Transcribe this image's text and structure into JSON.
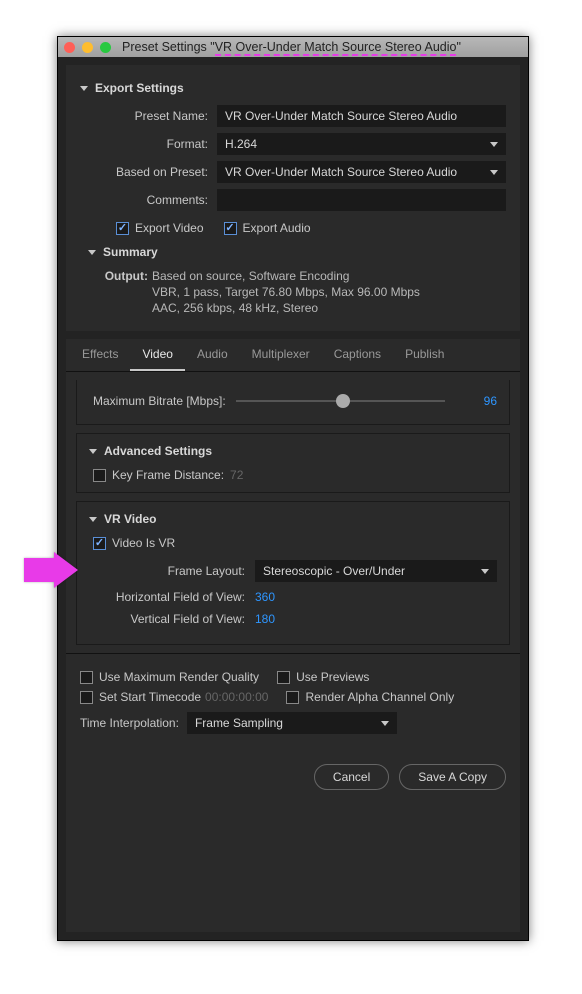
{
  "window": {
    "title": "Preset Settings \"VR Over-Under Match Source Stereo Audio\""
  },
  "exportSettings": {
    "header": "Export Settings",
    "presetName": {
      "label": "Preset Name:",
      "value": "VR Over-Under Match Source Stereo Audio"
    },
    "format": {
      "label": "Format:",
      "value": "H.264"
    },
    "basedOn": {
      "label": "Based on Preset:",
      "value": "VR Over-Under Match Source Stereo Audio"
    },
    "comments": {
      "label": "Comments:",
      "value": ""
    },
    "exportVideo": {
      "label": "Export Video",
      "checked": true
    },
    "exportAudio": {
      "label": "Export Audio",
      "checked": true
    },
    "summary": {
      "header": "Summary",
      "outputLabel": "Output:",
      "line1": "Based on source, Software Encoding",
      "line2": "VBR, 1 pass, Target 76.80 Mbps, Max 96.00 Mbps",
      "line3": "AAC, 256 kbps, 48 kHz, Stereo"
    }
  },
  "tabs": {
    "effects": "Effects",
    "video": "Video",
    "audio": "Audio",
    "multiplexer": "Multiplexer",
    "captions": "Captions",
    "publish": "Publish",
    "active": "video"
  },
  "videoTab": {
    "maxBitrate": {
      "label": "Maximum Bitrate [Mbps]:",
      "value": "96"
    },
    "advanced": {
      "header": "Advanced Settings",
      "keyFrame": {
        "label": "Key Frame Distance:",
        "value": "72",
        "checked": false
      }
    },
    "vr": {
      "header": "VR Video",
      "isVR": {
        "label": "Video Is VR",
        "checked": true
      },
      "frameLayout": {
        "label": "Frame Layout:",
        "value": "Stereoscopic - Over/Under"
      },
      "hfov": {
        "label": "Horizontal Field of View:",
        "value": "360"
      },
      "vfov": {
        "label": "Vertical Field of View:",
        "value": "180"
      }
    }
  },
  "bottom": {
    "maxQuality": {
      "label": "Use Maximum Render Quality",
      "checked": false
    },
    "usePreviews": {
      "label": "Use Previews",
      "checked": false
    },
    "startTimecode": {
      "label": "Set Start Timecode",
      "value": "00:00:00:00",
      "checked": false
    },
    "alphaOnly": {
      "label": "Render Alpha Channel Only",
      "checked": false
    },
    "timeInterp": {
      "label": "Time Interpolation:",
      "value": "Frame Sampling"
    },
    "cancel": "Cancel",
    "saveCopy": "Save A Copy"
  }
}
